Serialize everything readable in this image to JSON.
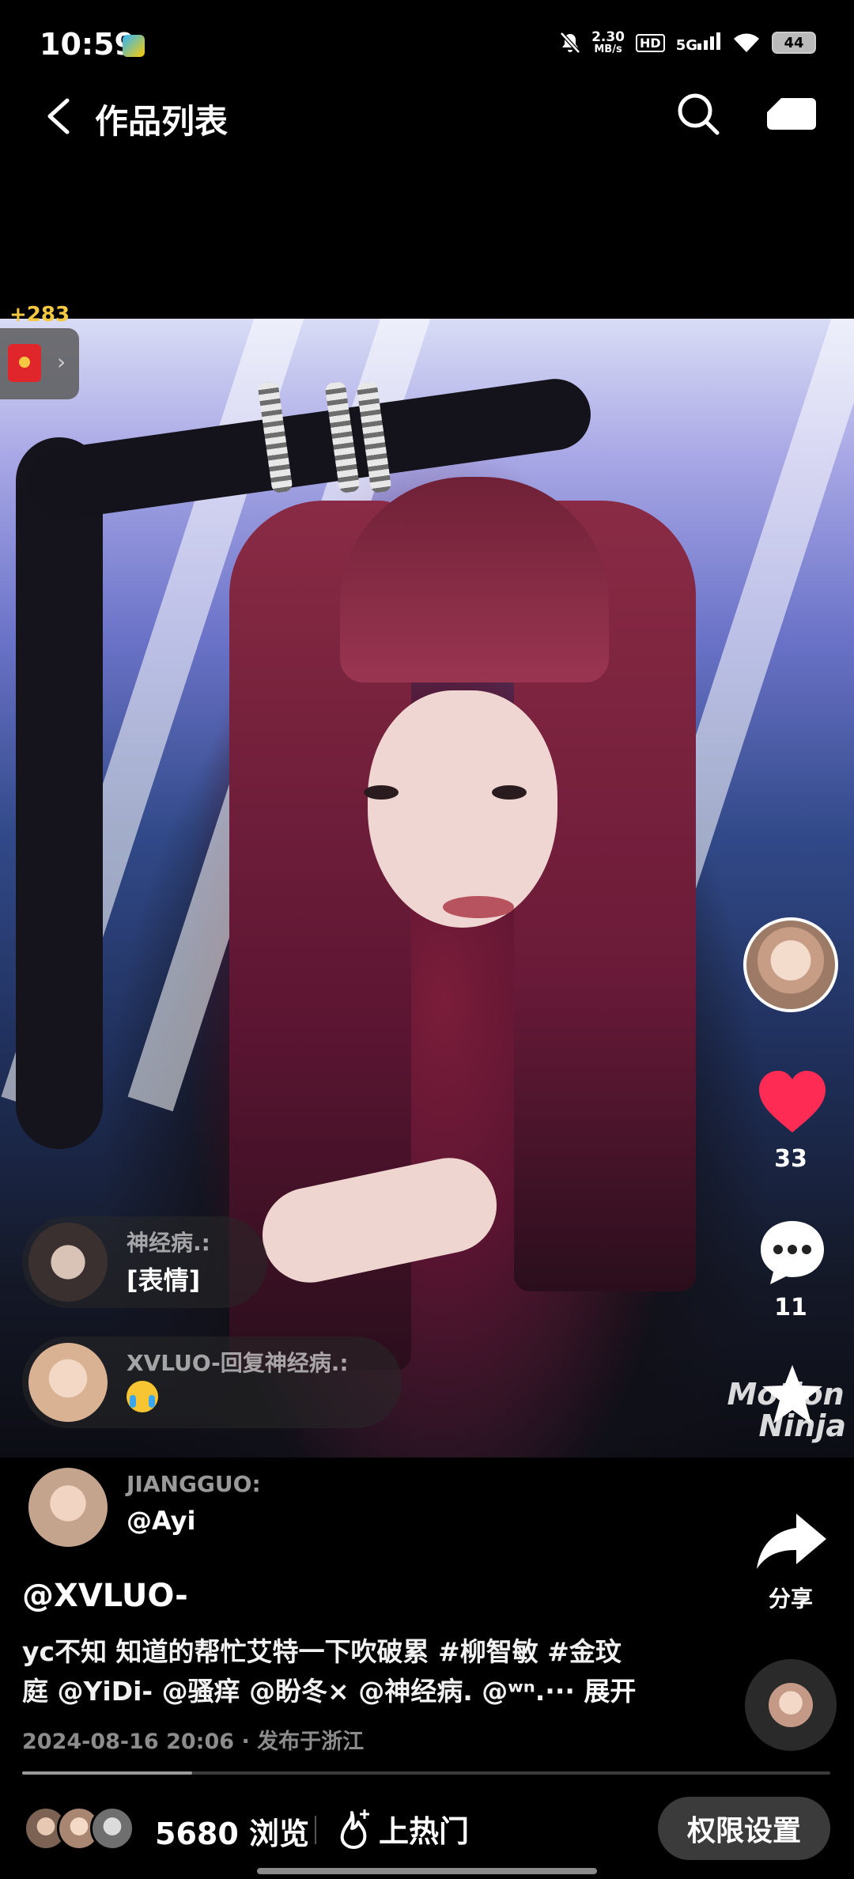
{
  "status_bar": {
    "time": "10:59",
    "net_speed_value": "2.30",
    "net_speed_unit": "MB/s",
    "hd": "HD",
    "network": "5G",
    "battery": "44"
  },
  "nav": {
    "title": "作品列表"
  },
  "red_packet": {
    "count": "+283"
  },
  "video": {
    "watermark_line1": "Motion",
    "watermark_line2": "Ninja"
  },
  "right_rail": {
    "like_count": "33",
    "comment_count": "11",
    "share_label": "分享"
  },
  "danmaku": [
    {
      "name": "神经病.:",
      "text": "[表情]"
    },
    {
      "name": "XVLUO-回复神经病.:",
      "text": ""
    },
    {
      "name": "JIANGGUO:",
      "text": "@Ayi"
    }
  ],
  "caption": {
    "author": "@XVLUO-",
    "line1": "yc不知 知道的帮忙艾特一下吹破累 #柳智敏 #金玟",
    "line2": "庭 @YiDi- @骚痒 @盼冬× @神经病. @ʷⁿ.··· ",
    "expand": "展开",
    "meta": "2024-08-16 20:06 · 发布于浙江"
  },
  "progress": {
    "fraction": 0.21
  },
  "bottom_bar": {
    "views": "5680 浏览",
    "hot_label": "上热门",
    "permission_label": "权限设置"
  },
  "colors": {
    "like_red": "#fe2c55",
    "gold": "#f5c842"
  }
}
